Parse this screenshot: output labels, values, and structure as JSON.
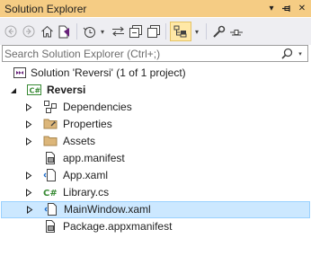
{
  "window": {
    "title": "Solution Explorer",
    "pin_glyph": "⊣",
    "close_glyph": "✕",
    "menu_glyph": "▾"
  },
  "toolbar": {
    "icons": [
      "back-icon",
      "forward-icon",
      "home-icon",
      "switch-views-icon",
      "pending-changes-filter-icon",
      "sync-with-active-document-icon",
      "collapse-all-icon",
      "show-all-files-icon",
      "preview-selected-items-icon",
      "properties-icon",
      "settings-icon"
    ],
    "dropdown_glyph": "▾"
  },
  "search": {
    "placeholder": "Search Solution Explorer (Ctrl+;)",
    "value": "",
    "dropdown_glyph": "▾"
  },
  "tree": {
    "solution": {
      "label": "Solution 'Reversi' (1 of 1 project)",
      "icon": "solution-icon"
    },
    "project": {
      "label": "Reversi",
      "icon": "csharp-project-icon",
      "expanded": true
    },
    "items": [
      {
        "label": "Dependencies",
        "icon": "dependencies-icon",
        "expandable": true
      },
      {
        "label": "Properties",
        "icon": "properties-folder-icon",
        "expandable": true
      },
      {
        "label": "Assets",
        "icon": "folder-icon",
        "expandable": true
      },
      {
        "label": "app.manifest",
        "icon": "manifest-file-icon",
        "expandable": false
      },
      {
        "label": "App.xaml",
        "icon": "xaml-file-icon",
        "expandable": true
      },
      {
        "label": "Library.cs",
        "icon": "csharp-file-icon",
        "expandable": true
      },
      {
        "label": "MainWindow.xaml",
        "icon": "xaml-file-icon",
        "expandable": true,
        "selected": true
      },
      {
        "label": "Package.appxmanifest",
        "icon": "manifest-file-icon",
        "expandable": false
      }
    ]
  },
  "colors": {
    "title_bar": "#f5cc84",
    "toolbar": "#eeeef2",
    "selection": "#cce8ff",
    "selection_border": "#99d1ff",
    "csharp_accent": "#388a34",
    "folder": "#dcb67a"
  }
}
